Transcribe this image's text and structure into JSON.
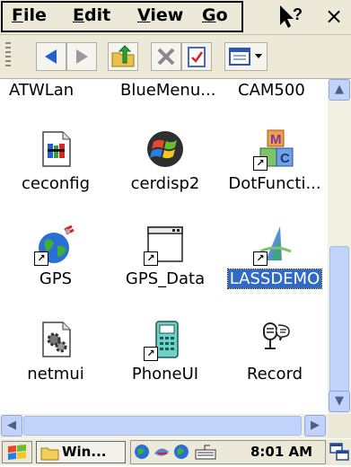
{
  "menu": {
    "file": {
      "acc": "F",
      "rest": "ile"
    },
    "edit": {
      "acc": "E",
      "rest": "dit"
    },
    "view": {
      "acc": "V",
      "rest": "iew"
    },
    "go": {
      "acc": "G",
      "rest": "o"
    },
    "help_icon": "help-icon",
    "close": "×"
  },
  "toolbar": {
    "buttons": [
      "back-icon",
      "forward-icon",
      "up-folder-icon",
      "delete-icon",
      "properties-icon",
      "view-mode-icon"
    ]
  },
  "top_row": [
    "ATWLan",
    "BlueMenu...",
    "CAM500"
  ],
  "icons": [
    {
      "label": "ceconfig",
      "icon": "ceconfig-icon"
    },
    {
      "label": "cerdisp2",
      "icon": "windows-flag-icon"
    },
    {
      "label": "DotFuncti...",
      "icon": "blocks-icon"
    },
    {
      "label": "GPS",
      "icon": "globe-satellite-icon"
    },
    {
      "label": "GPS_Data",
      "icon": "window-icon"
    },
    {
      "label": "LASSDEMO",
      "icon": "lassdemo-icon",
      "selected": true
    },
    {
      "label": "netmui",
      "icon": "gear-document-icon"
    },
    {
      "label": "PhoneUI",
      "icon": "phone-icon"
    },
    {
      "label": "Record",
      "icon": "microphone-icon"
    }
  ],
  "taskbar": {
    "task_label": "Win...",
    "clock": "8:01 AM"
  },
  "colors": {
    "selection": "#316ac5",
    "scroll_blue": "#c1d3fb",
    "chrome": "#ece9d8"
  }
}
